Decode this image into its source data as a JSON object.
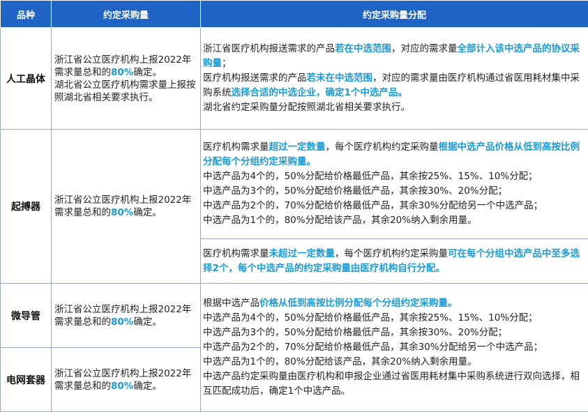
{
  "headers": [
    "品种",
    "约定采购量",
    "约定采购量分配"
  ],
  "rows": [
    {
      "category": "人工晶体",
      "volume": [
        {
          "t": "浙江省公立医疗机构上报2022年需求量总和的"
        },
        {
          "t": "80%",
          "h": true
        },
        {
          "t": "确定。"
        },
        {
          "t": "湖北省公立医疗机构需求量上报按照湖北省相关要求执行。",
          "br": true
        }
      ],
      "alloc": [
        [
          {
            "t": "浙江省医疗机构报送需求的产品"
          },
          {
            "t": "若在中选范围",
            "h": true
          },
          {
            "t": "，对应的需求量"
          },
          {
            "t": "全部计入该中选产品的协议采购量",
            "h": true
          },
          {
            "t": "；"
          }
        ],
        [
          {
            "t": "医疗机构报送需求的产品"
          },
          {
            "t": "若未在中选范围",
            "h": true
          },
          {
            "t": "，对应的需求量由医疗机构通过省医用耗材集中采购系统"
          },
          {
            "t": "选择合适的中选企业，确定1个中选产品。",
            "h": true
          }
        ],
        [
          {
            "t": "湖北省约定采购量分配按照湖北省相关要求执行。"
          }
        ]
      ]
    },
    {
      "category": "起搏器",
      "volume": [
        {
          "t": "浙江省公立医疗机构上报2022年需求量总和的"
        },
        {
          "t": "80%",
          "h": true
        },
        {
          "t": "确定。"
        }
      ],
      "alloc_a": [
        [
          {
            "t": "医疗机构需求量"
          },
          {
            "t": "超过一定数量",
            "h": true
          },
          {
            "t": "，每个医疗机构约定采购量"
          },
          {
            "t": "根据中选产品价格从低到高按比例分配每个分组约定采购量。",
            "h": true
          }
        ],
        [
          {
            "t": "中选产品为4个的，50%分配给价格最低产品，其余按25%、15%、10%分配；"
          }
        ],
        [
          {
            "t": "中选产品为3个的，50%分配给价格最低产品，其余按30%、20%分配；"
          }
        ],
        [
          {
            "t": "中选产品为2个的，70%分配给价格最低产品，其余30%分配给另一个中选产品；"
          }
        ],
        [
          {
            "t": "中选产品为1个的，80%分配给该产品，其余20%纳入剩余用量。"
          }
        ]
      ],
      "alloc_b": [
        [
          {
            "t": "医疗机构需求量"
          },
          {
            "t": "未超过一定数量",
            "h": true
          },
          {
            "t": "，每个医疗机构约定采购量"
          },
          {
            "t": "可在每个分组中选产品中至多选择2个，每个中选产品的约定采购量由医疗机构自行分配。",
            "h": true
          }
        ]
      ]
    },
    {
      "category": "微导管",
      "volume": [
        {
          "t": "浙江省公立医疗机构上报2022年需求量总和的"
        },
        {
          "t": "80%",
          "h": true
        },
        {
          "t": "确定。"
        }
      ]
    },
    {
      "category": "电网套器",
      "volume": [
        {
          "t": "浙江省公立医疗机构上报2022年需求量总和的"
        },
        {
          "t": "80%",
          "h": true
        },
        {
          "t": "确定。"
        }
      ]
    }
  ],
  "shared_alloc": [
    [
      {
        "t": "根据中选产品"
      },
      {
        "t": "价格从低到高按比例分配每个分组约定采购量。",
        "h": true
      }
    ],
    [
      {
        "t": "中选产品为4个的，50%分配给价格最低产品，其余按25%、15%、10%分配；"
      }
    ],
    [
      {
        "t": "中选产品为3个的，50%分配给价格最低产品，其余按30%、20%分配；"
      }
    ],
    [
      {
        "t": "中选产品为2个的，70%分配给价格最低产品，其余30%分配给另一个中选产品；"
      }
    ],
    [
      {
        "t": "中选产品为1个的，80%分配给该产品，其余20%纳入剩余用量。"
      }
    ],
    [
      {
        "t": "中选产品约定采购量由医疗机构和申报企业通过省医用耗材集中采购系统进行双向选择，相互匹配成功后，确定1个中选产品。"
      }
    ]
  ],
  "colors": {
    "header_bg": "#1f63c4",
    "highlight": "#1a9ad6",
    "border": "#9aa9bd"
  }
}
